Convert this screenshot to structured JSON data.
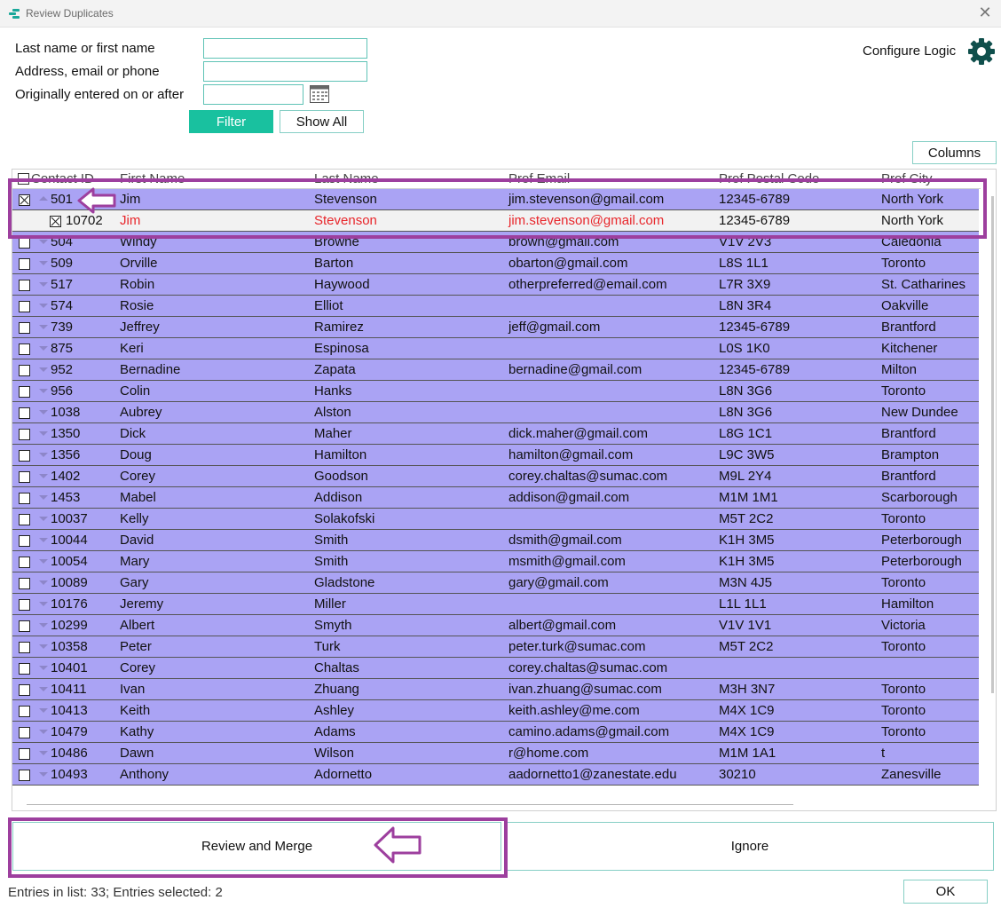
{
  "window": {
    "title": "Review Duplicates"
  },
  "filters": {
    "name_label": "Last name or first name",
    "name_value": "",
    "contact_label": "Address, email or phone",
    "contact_value": "",
    "date_label": "Originally entered on or after",
    "date_value": "",
    "filter_button": "Filter",
    "show_all_button": "Show All"
  },
  "configure_logic_label": "Configure Logic",
  "columns_button": "Columns",
  "table": {
    "headers": {
      "contact_id": "Contact ID",
      "first_name": "First Name",
      "last_name": "Last Name",
      "email": "Prof Email",
      "postal": "Prof Postal Code",
      "city": "Prof City"
    },
    "rows": [
      {
        "id": "501",
        "first": "Jim",
        "last": "Stevenson",
        "email": "jim.stevenson@gmail.com",
        "postal": "12345-6789",
        "city": "North York",
        "checked": true,
        "expanded": true,
        "child": false
      },
      {
        "id": "10702",
        "first": "Jim",
        "last": "Stevenson",
        "email": "jim.stevenson@gmail.com",
        "postal": "12345-6789",
        "city": "North York",
        "checked": true,
        "expanded": false,
        "child": true
      },
      {
        "id": "504",
        "first": "Windy",
        "last": "Browne",
        "email": "brown@gmail.com",
        "postal": "V1V 2V3",
        "city": "Caledonia",
        "checked": false,
        "expanded": false,
        "child": false
      },
      {
        "id": "509",
        "first": "Orville",
        "last": "Barton",
        "email": "obarton@gmail.com",
        "postal": "L8S 1L1",
        "city": "Toronto",
        "checked": false,
        "expanded": false,
        "child": false
      },
      {
        "id": "517",
        "first": "Robin",
        "last": "Haywood",
        "email": "otherpreferred@email.com",
        "postal": "L7R 3X9",
        "city": "St. Catharines",
        "checked": false,
        "expanded": false,
        "child": false
      },
      {
        "id": "574",
        "first": "Rosie",
        "last": "Elliot",
        "email": "",
        "postal": "L8N 3R4",
        "city": "Oakville",
        "checked": false,
        "expanded": false,
        "child": false
      },
      {
        "id": "739",
        "first": "Jeffrey",
        "last": "Ramirez",
        "email": "jeff@gmail.com",
        "postal": "12345-6789",
        "city": "Brantford",
        "checked": false,
        "expanded": false,
        "child": false
      },
      {
        "id": "875",
        "first": "Keri",
        "last": "Espinosa",
        "email": "",
        "postal": "L0S 1K0",
        "city": "Kitchener",
        "checked": false,
        "expanded": false,
        "child": false
      },
      {
        "id": "952",
        "first": "Bernadine",
        "last": "Zapata",
        "email": "bernadine@gmail.com",
        "postal": "12345-6789",
        "city": "Milton",
        "checked": false,
        "expanded": false,
        "child": false
      },
      {
        "id": "956",
        "first": "Colin",
        "last": "Hanks",
        "email": "",
        "postal": "L8N 3G6",
        "city": "Toronto",
        "checked": false,
        "expanded": false,
        "child": false
      },
      {
        "id": "1038",
        "first": "Aubrey",
        "last": "Alston",
        "email": "",
        "postal": "L8N 3G6",
        "city": "New Dundee",
        "checked": false,
        "expanded": false,
        "child": false
      },
      {
        "id": "1350",
        "first": "Dick",
        "last": "Maher",
        "email": "dick.maher@gmail.com",
        "postal": "L8G 1C1",
        "city": "Brantford",
        "checked": false,
        "expanded": false,
        "child": false
      },
      {
        "id": "1356",
        "first": "Doug",
        "last": "Hamilton",
        "email": "hamilton@gmail.com",
        "postal": "L9C 3W5",
        "city": "Brampton",
        "checked": false,
        "expanded": false,
        "child": false
      },
      {
        "id": "1402",
        "first": "Corey",
        "last": "Goodson",
        "email": "corey.chaltas@sumac.com",
        "postal": "M9L 2Y4",
        "city": "Brantford",
        "checked": false,
        "expanded": false,
        "child": false
      },
      {
        "id": "1453",
        "first": "Mabel",
        "last": "Addison",
        "email": "addison@gmail.com",
        "postal": "M1M 1M1",
        "city": "Scarborough",
        "checked": false,
        "expanded": false,
        "child": false
      },
      {
        "id": "10037",
        "first": "Kelly",
        "last": "Solakofski",
        "email": "",
        "postal": "M5T 2C2",
        "city": "Toronto",
        "checked": false,
        "expanded": false,
        "child": false
      },
      {
        "id": "10044",
        "first": "David",
        "last": "Smith",
        "email": "dsmith@gmail.com",
        "postal": "K1H 3M5",
        "city": "Peterborough",
        "checked": false,
        "expanded": false,
        "child": false
      },
      {
        "id": "10054",
        "first": "Mary",
        "last": "Smith",
        "email": "msmith@gmail.com",
        "postal": "K1H 3M5",
        "city": "Peterborough",
        "checked": false,
        "expanded": false,
        "child": false
      },
      {
        "id": "10089",
        "first": "Gary",
        "last": "Gladstone",
        "email": "gary@gmail.com",
        "postal": "M3N 4J5",
        "city": "Toronto",
        "checked": false,
        "expanded": false,
        "child": false
      },
      {
        "id": "10176",
        "first": "Jeremy",
        "last": "Miller",
        "email": "",
        "postal": "L1L 1L1",
        "city": "Hamilton",
        "checked": false,
        "expanded": false,
        "child": false
      },
      {
        "id": "10299",
        "first": "Albert",
        "last": "Smyth",
        "email": "albert@gmail.com",
        "postal": "V1V 1V1",
        "city": "Victoria",
        "checked": false,
        "expanded": false,
        "child": false
      },
      {
        "id": "10358",
        "first": "Peter",
        "last": "Turk",
        "email": "peter.turk@sumac.com",
        "postal": "M5T 2C2",
        "city": "Toronto",
        "checked": false,
        "expanded": false,
        "child": false
      },
      {
        "id": "10401",
        "first": "Corey",
        "last": "Chaltas",
        "email": "corey.chaltas@sumac.com",
        "postal": "",
        "city": "",
        "checked": false,
        "expanded": false,
        "child": false
      },
      {
        "id": "10411",
        "first": "Ivan",
        "last": "Zhuang",
        "email": "ivan.zhuang@sumac.com",
        "postal": "M3H 3N7",
        "city": "Toronto",
        "checked": false,
        "expanded": false,
        "child": false
      },
      {
        "id": "10413",
        "first": "Keith",
        "last": "Ashley",
        "email": "keith.ashley@me.com",
        "postal": "M4X 1C9",
        "city": "Toronto",
        "checked": false,
        "expanded": false,
        "child": false
      },
      {
        "id": "10479",
        "first": "Kathy",
        "last": "Adams",
        "email": "camino.adams@gmail.com",
        "postal": "M4X 1C9",
        "city": "Toronto",
        "checked": false,
        "expanded": false,
        "child": false
      },
      {
        "id": "10486",
        "first": "Dawn",
        "last": "Wilson",
        "email": "r@home.com",
        "postal": "M1M 1A1",
        "city": "t",
        "checked": false,
        "expanded": false,
        "child": false
      },
      {
        "id": "10493",
        "first": "Anthony",
        "last": "Adornetto",
        "email": "aadornetto1@zanestate.edu",
        "postal": "30210",
        "city": "Zanesville",
        "checked": false,
        "expanded": false,
        "child": false
      }
    ]
  },
  "actions": {
    "review_merge": "Review and Merge",
    "ignore": "Ignore",
    "ok": "OK"
  },
  "status": "Entries in list: 33; Entries selected: 2",
  "colors": {
    "row_bg": "#aaa3f4",
    "accent": "#19c19f",
    "highlight": "#9d3f9e",
    "duplicate_text": "#e8262b"
  }
}
